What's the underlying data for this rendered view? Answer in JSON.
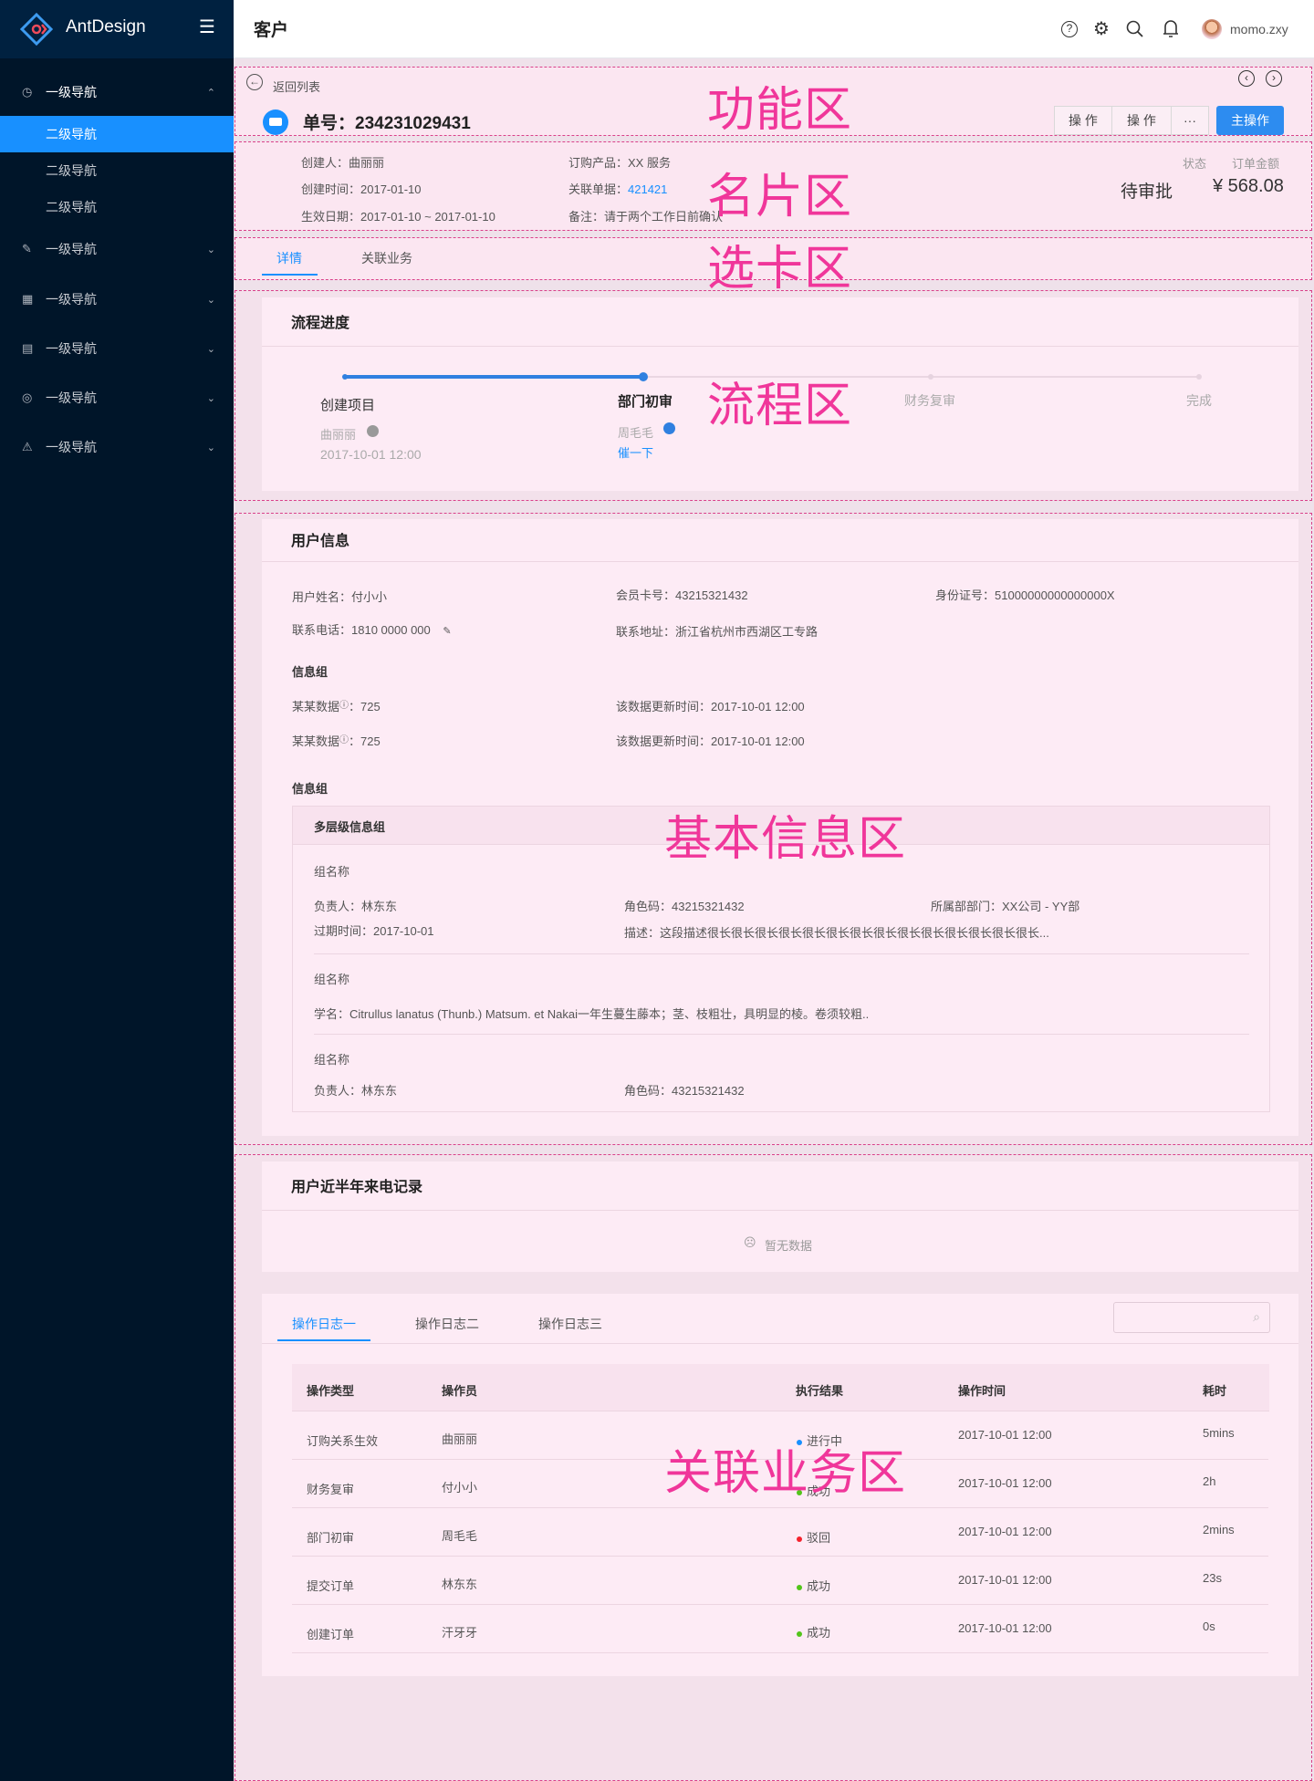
{
  "app": {
    "name": "AntDesign",
    "page_title": "客户"
  },
  "sidebar": {
    "items": [
      {
        "label": "一级导航",
        "icon": "dashboard-icon",
        "expanded": true,
        "children": [
          {
            "label": "二级导航",
            "selected": true
          },
          {
            "label": "二级导航"
          },
          {
            "label": "二级导航"
          }
        ]
      },
      {
        "label": "一级导航",
        "icon": "edit-icon"
      },
      {
        "label": "一级导航",
        "icon": "table-icon"
      },
      {
        "label": "一级导航",
        "icon": "profile-icon"
      },
      {
        "label": "一级导航",
        "icon": "check-circle-icon"
      },
      {
        "label": "一级导航",
        "icon": "warning-icon"
      }
    ]
  },
  "header": {
    "user": "momo.zxy",
    "icons": [
      "question-icon",
      "setting-icon",
      "search-icon",
      "bell-icon"
    ]
  },
  "zones": {
    "function": "功能区",
    "card": "名片区",
    "tabs": "选卡区",
    "process": "流程区",
    "info": "基本信息区",
    "related": "关联业务区"
  },
  "function_bar": {
    "back": "返回列表",
    "title": "单号：234231029431",
    "buttons": [
      "操 作",
      "操 作",
      "···"
    ],
    "primary": "主操作"
  },
  "summary": {
    "fields": [
      {
        "label": "创建人：",
        "value": "曲丽丽"
      },
      {
        "label": "创建时间：",
        "value": "2017-01-10"
      },
      {
        "label": "生效日期：",
        "value": "2017-01-10 ~ 2017-01-10"
      },
      {
        "label": "订购产品：",
        "value": "XX 服务"
      },
      {
        "label": "关联单据：",
        "value": "421421"
      },
      {
        "label": "备注：",
        "value": "请于两个工作日前确认"
      }
    ],
    "status_label": "状态",
    "status": "待审批",
    "amount_label": "订单金额",
    "amount": "¥ 568.08"
  },
  "tabs": [
    {
      "label": "详情",
      "active": true
    },
    {
      "label": "关联业务"
    }
  ],
  "process": {
    "title": "流程进度",
    "steps": [
      {
        "title": "创建项目",
        "person": "曲丽丽",
        "time": "2017-10-01 12:00"
      },
      {
        "title": "部门初审",
        "person": "周毛毛",
        "action": "催一下"
      },
      {
        "title": "财务复审"
      },
      {
        "title": "完成"
      }
    ],
    "current_step": 2
  },
  "user_info": {
    "title": "用户信息",
    "fields": [
      {
        "label": "用户姓名：",
        "value": "付小小"
      },
      {
        "label": "会员卡号：",
        "value": "43215321432"
      },
      {
        "label": "身份证号：",
        "value": "51000000000000000X"
      },
      {
        "label": "联系电话：",
        "value": "1810 0000 000"
      },
      {
        "label": "联系地址：",
        "value": "浙江省杭州市西湖区工专路"
      }
    ],
    "group1": {
      "title": "信息组",
      "rows": [
        {
          "label": "某某数据",
          "value": "725",
          "time_label": "该数据更新时间：",
          "time": "2017-10-01 12:00"
        },
        {
          "label": "某某数据",
          "value": "725",
          "time_label": "该数据更新时间：",
          "time": "2017-10-01 12:00"
        }
      ]
    },
    "group2": {
      "title": "信息组",
      "box_title": "多层级信息组",
      "sub1": {
        "name": "组名称",
        "owner_label": "负责人：",
        "owner": "林东东",
        "code_label": "角色码：",
        "code": "43215321432",
        "dept_label": "所属部部门：",
        "dept": "XX公司 - YY部",
        "expire_label": "过期时间：",
        "expire": "2017-10-01",
        "desc_label": "描述：",
        "desc": "这段描述很长很长很长很长很长很长很长很长很长很长很长很长很长很长..."
      },
      "sub2": {
        "name": "组名称",
        "sci": "学名：Citrullus lanatus (Thunb.) Matsum. et Nakai一年生蔓生藤本；茎、枝粗壮，具明显的棱。卷须较粗.."
      },
      "sub3": {
        "name": "组名称",
        "owner_label": "负责人：",
        "owner": "林东东",
        "code_label": "角色码：",
        "code": "43215321432"
      }
    }
  },
  "calls": {
    "title": "用户近半年来电记录",
    "empty": "暂无数据"
  },
  "logs": {
    "tabs": [
      "操作日志一",
      "操作日志二",
      "操作日志三"
    ],
    "search_placeholder": "",
    "columns": [
      "操作类型",
      "操作员",
      "执行结果",
      "操作时间",
      "耗时"
    ],
    "rows": [
      {
        "type": "订购关系生效",
        "op": "曲丽丽",
        "result": "进行中",
        "color": "#1890ff",
        "time": "2017-10-01 12:00",
        "dur": "5mins"
      },
      {
        "type": "财务复审",
        "op": "付小小",
        "result": "成功",
        "color": "#52c41a",
        "time": "2017-10-01 12:00",
        "dur": "2h"
      },
      {
        "type": "部门初审",
        "op": "周毛毛",
        "result": "驳回",
        "color": "#f5222d",
        "time": "2017-10-01 12:00",
        "dur": "2mins"
      },
      {
        "type": "提交订单",
        "op": "林东东",
        "result": "成功",
        "color": "#52c41a",
        "time": "2017-10-01 12:00",
        "dur": "23s"
      },
      {
        "type": "创建订单",
        "op": "汗牙牙",
        "result": "成功",
        "color": "#52c41a",
        "time": "2017-10-01 12:00",
        "dur": "0s"
      }
    ]
  }
}
